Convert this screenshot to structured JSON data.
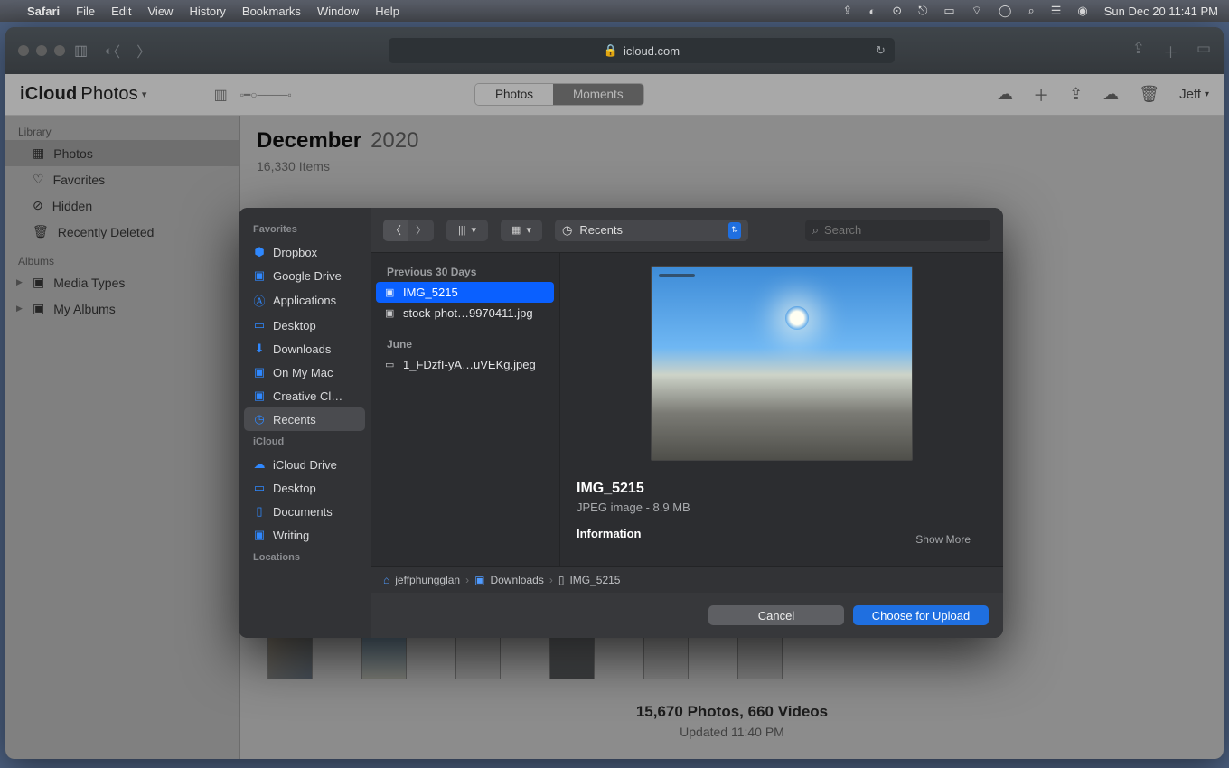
{
  "menubar": {
    "app": "Safari",
    "items": [
      "File",
      "Edit",
      "View",
      "History",
      "Bookmarks",
      "Window",
      "Help"
    ],
    "clock": "Sun Dec 20  11:41 PM"
  },
  "safari": {
    "url_host": "icloud.com"
  },
  "icloud": {
    "brand_a": "iCloud",
    "brand_b": "Photos",
    "seg_photos": "Photos",
    "seg_moments": "Moments",
    "user": "Jeff",
    "sidebar": {
      "library_hdr": "Library",
      "library": [
        "Photos",
        "Favorites",
        "Hidden",
        "Recently Deleted"
      ],
      "albums_hdr": "Albums",
      "albums": [
        "Media Types",
        "My Albums"
      ]
    },
    "main": {
      "month": "December",
      "year": "2020",
      "items": "16,330 Items",
      "stats_a": "15,670 Photos, 660 Videos",
      "stats_b": "Updated 11:40 PM"
    }
  },
  "picker": {
    "side": {
      "fav_hdr": "Favorites",
      "fav": [
        "Dropbox",
        "Google Drive",
        "Applications",
        "Desktop",
        "Downloads",
        "On My Mac",
        "Creative Cl…",
        "Recents"
      ],
      "icloud_hdr": "iCloud",
      "icloud": [
        "iCloud Drive",
        "Desktop",
        "Documents",
        "Writing"
      ],
      "loc_hdr": "Locations"
    },
    "loc_label": "Recents",
    "search_ph": "Search",
    "groups": {
      "g1": "Previous 30 Days",
      "g1_items": [
        "IMG_5215",
        "stock-phot…9970411.jpg"
      ],
      "g2": "June",
      "g2_items": [
        "1_FDzfI-yA…uVEKg.jpeg"
      ]
    },
    "preview": {
      "name": "IMG_5215",
      "sub": "JPEG image - 8.9 MB",
      "info": "Information",
      "showmore": "Show More"
    },
    "path": {
      "a": "jeffphungglan",
      "b": "Downloads",
      "c": "IMG_5215"
    },
    "actions": {
      "cancel": "Cancel",
      "choose": "Choose for Upload"
    }
  }
}
